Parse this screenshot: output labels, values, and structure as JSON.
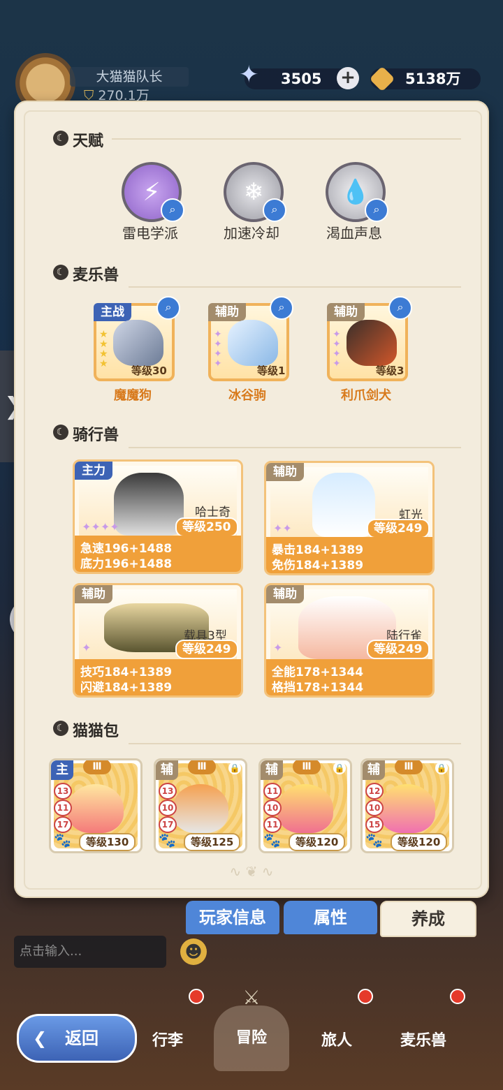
{
  "player": {
    "name": "大猫猫队长",
    "power": "270.1万"
  },
  "resources": {
    "gems": "3505",
    "coins": "5138万"
  },
  "sections": {
    "talent": "天赋",
    "pets": "麦乐兽",
    "mounts": "骑行兽",
    "bags": "猫猫包"
  },
  "talents": [
    {
      "label": "雷电学派"
    },
    {
      "label": "加速冷却"
    },
    {
      "label": "渴血声息"
    }
  ],
  "pets": [
    {
      "role": "主战",
      "level": "等级30",
      "name": "魔魔狗"
    },
    {
      "role": "辅助",
      "level": "等级1",
      "name": "冰谷驹"
    },
    {
      "role": "辅助",
      "level": "等级3",
      "name": "利爪剑犬"
    }
  ],
  "mounts": [
    {
      "role": "主力",
      "name": "哈士奇",
      "level": "等级250",
      "stat1": "急速196+1488",
      "stat2": "底力196+1488"
    },
    {
      "role": "辅助",
      "name": "虹光",
      "level": "等级249",
      "stat1": "暴击184+1389",
      "stat2": "免伤184+1389"
    },
    {
      "role": "辅助",
      "name": "载具3型",
      "level": "等级249",
      "stat1": "技巧184+1389",
      "stat2": "闪避184+1389"
    },
    {
      "role": "辅助",
      "name": "陆行雀",
      "level": "等级249",
      "stat1": "全能178+1344",
      "stat2": "格挡178+1344"
    }
  ],
  "bags": [
    {
      "role": "主",
      "grade": "Ⅲ",
      "level": "等级130",
      "nums": [
        "13",
        "11",
        "17"
      ]
    },
    {
      "role": "辅",
      "grade": "Ⅲ",
      "level": "等级125",
      "nums": [
        "13",
        "10",
        "17"
      ]
    },
    {
      "role": "辅",
      "grade": "Ⅲ",
      "level": "等级120",
      "nums": [
        "11",
        "10",
        "11"
      ]
    },
    {
      "role": "辅",
      "grade": "Ⅲ",
      "level": "等级120",
      "nums": [
        "12",
        "10",
        "15"
      ]
    }
  ],
  "tabs": {
    "info": "玩家信息",
    "attr": "属性",
    "train": "养成"
  },
  "chat": {
    "placeholder": "点击输入..."
  },
  "nav": {
    "back": "返回",
    "bag": "行李",
    "adventure": "冒险",
    "traveler": "旅人",
    "pets": "麦乐兽"
  },
  "colors": {
    "main_tag": "#3d63b5",
    "assist_tag": "#a38c6c",
    "tab_blue": "#4f86d8",
    "tab_active": "#f6efe0",
    "accent_orange": "#f0a03a"
  }
}
